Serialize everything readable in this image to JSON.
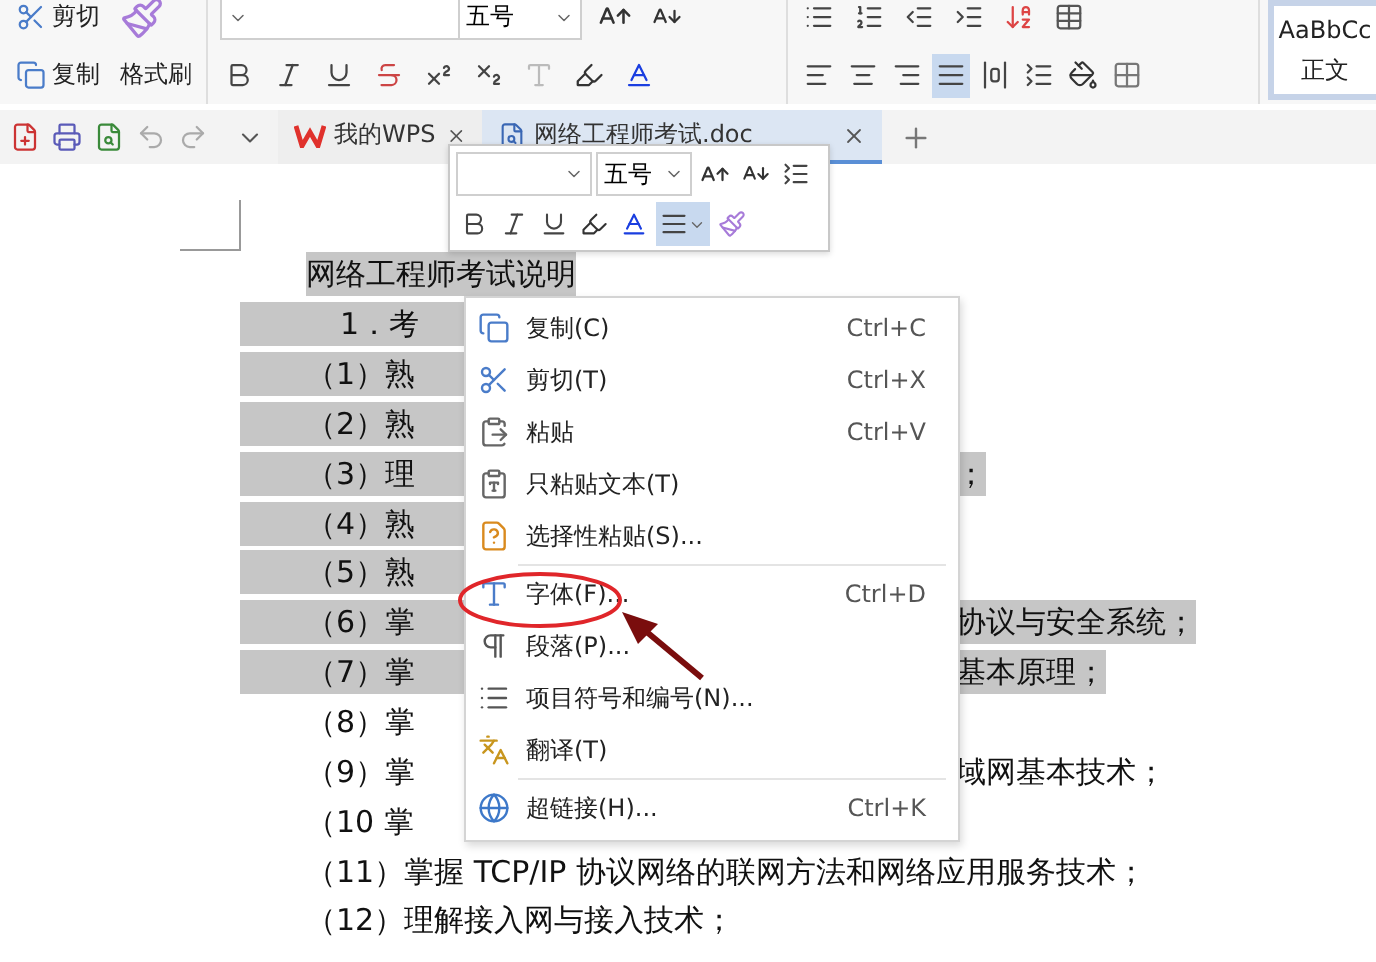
{
  "ribbon": {
    "clipboard": {
      "cut": "剪切",
      "copy": "复制",
      "format_painter": "格式刷"
    },
    "font": {
      "size": "五号"
    },
    "paragraph": {
      "alignment": [
        {
          "kind": "left",
          "selected": false
        },
        {
          "kind": "center",
          "selected": false
        },
        {
          "kind": "right",
          "selected": false
        },
        {
          "kind": "justify",
          "selected": true
        },
        {
          "kind": "distributed",
          "selected": false
        }
      ]
    },
    "styles": {
      "preview": "AaBbCc",
      "name": "正文"
    }
  },
  "tabs": [
    {
      "kind": "home",
      "label": "我的WPS",
      "selected": false
    },
    {
      "kind": "document",
      "label": "网络工程师考试.doc",
      "selected": true
    }
  ],
  "mini_toolbar": {
    "font_size": "五号",
    "align_active": true
  },
  "document": {
    "lines": [
      {
        "kind": "title",
        "text": "网络工程师考试说明",
        "selected": true
      },
      {
        "kind": "indented",
        "text": "1．考",
        "selected": true
      },
      {
        "kind": "item",
        "text": "（1）熟",
        "selected": true
      },
      {
        "kind": "item",
        "text": "（2）熟",
        "selected": true
      },
      {
        "kind": "item",
        "text": "（3）理",
        "right": "；",
        "selected": true
      },
      {
        "kind": "item",
        "text": "（4）熟",
        "selected": true
      },
      {
        "kind": "item",
        "text": "（5）熟",
        "selected": true
      },
      {
        "kind": "item",
        "text": "（6）掌",
        "right": "协议与安全系统；",
        "selected": true
      },
      {
        "kind": "item",
        "text": "（7）掌",
        "right": "基本原理；",
        "selected": true
      },
      {
        "kind": "item",
        "text": "（8）掌",
        "selected": false
      },
      {
        "kind": "item",
        "text": "（9）掌",
        "right": "域网基本技术；",
        "selected": false
      },
      {
        "kind": "item",
        "text": "（10 掌",
        "selected": false
      },
      {
        "kind": "item",
        "text": "（11）掌握 TCP/IP 协议网络的联网方法和网络应用服务技术；",
        "selected": false
      },
      {
        "kind": "item",
        "text": "（12）理解接入网与接入技术；",
        "selected": false
      }
    ]
  },
  "context_menu": {
    "items": [
      {
        "kind": "copy",
        "label": "复制(C)",
        "shortcut": "Ctrl+C",
        "separator_before": false,
        "circled": false
      },
      {
        "kind": "cut",
        "label": "剪切(T)",
        "shortcut": "Ctrl+X",
        "separator_before": false,
        "circled": false
      },
      {
        "kind": "paste",
        "label": "粘贴",
        "shortcut": "Ctrl+V",
        "separator_before": false,
        "circled": false
      },
      {
        "kind": "paste_text",
        "label": "只粘贴文本(T)",
        "separator_before": false,
        "circled": false
      },
      {
        "kind": "paste_special",
        "label": "选择性粘贴(S)...",
        "separator_before": false,
        "circled": false
      },
      {
        "kind": "font",
        "label": "字体(F)...",
        "shortcut": "Ctrl+D",
        "separator_before": true,
        "circled": true
      },
      {
        "kind": "paragraph",
        "label": "段落(P)...",
        "separator_before": false,
        "circled": false
      },
      {
        "kind": "list",
        "label": "项目符号和编号(N)...",
        "separator_before": false,
        "circled": false
      },
      {
        "kind": "translate",
        "label": "翻译(T)",
        "separator_before": false,
        "circled": false
      },
      {
        "kind": "link",
        "label": "超链接(H)...",
        "shortcut": "Ctrl+K",
        "separator_before": true,
        "circled": false
      }
    ]
  }
}
